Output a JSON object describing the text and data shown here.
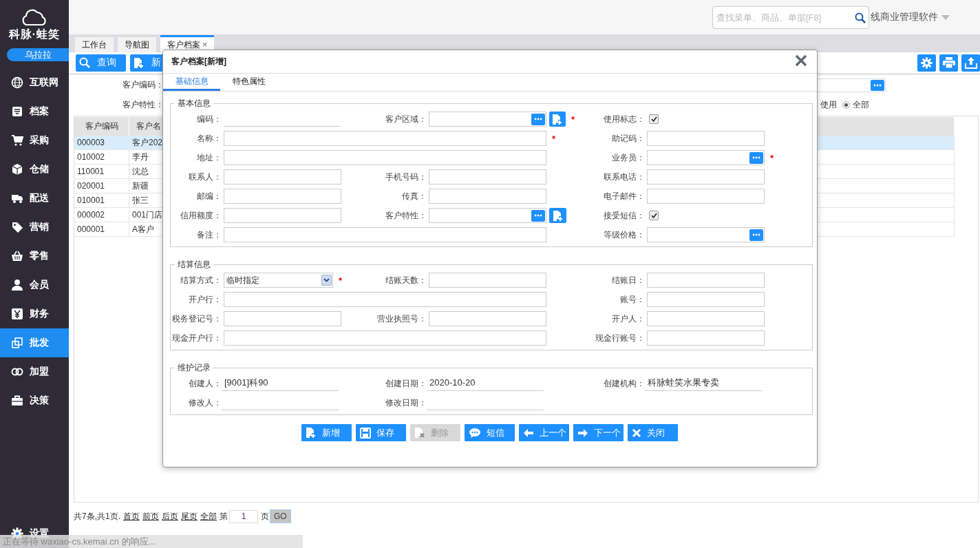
{
  "sidebar": {
    "logo": "科脉·蛙笑",
    "user": "乌拉拉",
    "items": [
      {
        "label": "互联网",
        "selected": false
      },
      {
        "label": "档案",
        "selected": false
      },
      {
        "label": "采购",
        "selected": false
      },
      {
        "label": "仓储",
        "selected": false
      },
      {
        "label": "配送",
        "selected": false
      },
      {
        "label": "营销",
        "selected": false
      },
      {
        "label": "零售",
        "selected": false
      },
      {
        "label": "会员",
        "selected": false
      },
      {
        "label": "财务",
        "selected": false
      },
      {
        "label": "批发",
        "selected": true
      },
      {
        "label": "加盟",
        "selected": false
      },
      {
        "label": "决策",
        "selected": false
      }
    ],
    "settings": "设置"
  },
  "topbar": {
    "search_placeholder": "查找菜单、商品、单据[F8]",
    "product": "线商业管理软件"
  },
  "tabs": [
    {
      "label": "工作台",
      "selected": false
    },
    {
      "label": "导航图",
      "selected": false
    },
    {
      "label": "客户档案",
      "selected": true,
      "close": "×"
    }
  ],
  "toolbar": {
    "buttons": [
      {
        "kind": "search",
        "label": "查询"
      },
      {
        "kind": "add",
        "label": "新"
      }
    ]
  },
  "filters": {
    "fields": [
      {
        "label": "客户编码："
      },
      {
        "label": "客户特性："
      }
    ],
    "partial_label": "使用",
    "radios": [
      {
        "label": "全部",
        "selected": true
      }
    ]
  },
  "table": {
    "columns": [
      "客户编码",
      "客户名"
    ],
    "rows": [
      {
        "cells": [
          "000003",
          "客户202"
        ],
        "selected": true
      },
      {
        "cells": [
          "010002",
          "李丹"
        ],
        "selected": false
      },
      {
        "cells": [
          "110001",
          "沈总"
        ],
        "selected": false
      },
      {
        "cells": [
          "020001",
          "新疆"
        ],
        "selected": false
      },
      {
        "cells": [
          "010001",
          "张三"
        ],
        "selected": false
      },
      {
        "cells": [
          "000002",
          "001门店"
        ],
        "selected": false
      },
      {
        "cells": [
          "000001",
          "A客户"
        ],
        "selected": false
      }
    ]
  },
  "pager": {
    "summary": "共7条,共1页.",
    "links": [
      "首页",
      "前页",
      "后页",
      "尾页",
      "全部"
    ],
    "page_prefix": "第",
    "page": "1",
    "page_suffix": "页",
    "go": "GO"
  },
  "status_bar": "正在等待 waxiao-cs.kemai.cn 的响应...",
  "dialog": {
    "title": "客户档案[新增]",
    "tabs": [
      {
        "label": "基础信息",
        "selected": true
      },
      {
        "label": "特色属性",
        "selected": false
      }
    ],
    "sections": [
      {
        "title": "基本信息",
        "rows": [
          {
            "fields": [
              {
                "label": "编码：",
                "kind": "underline"
              },
              {
                "label": "客户区域：",
                "kind": "lookup",
                "add": true,
                "required_mark": "*"
              },
              {
                "label": "使用标志：",
                "kind": "checkbox",
                "checked": true
              }
            ]
          },
          {
            "fields": [
              {
                "label": "名称：",
                "kind": "text",
                "wide": true,
                "required_mark": "*"
              },
              {
                "label": "助记码：",
                "kind": "text"
              }
            ]
          },
          {
            "fields": [
              {
                "label": "地址：",
                "kind": "text",
                "wide": true
              },
              {
                "label": "业务员：",
                "kind": "lookup",
                "required_mark": "*"
              }
            ]
          },
          {
            "fields": [
              {
                "label": "联系人：",
                "kind": "text"
              },
              {
                "label": "手机号码：",
                "kind": "text"
              },
              {
                "label": "联系电话：",
                "kind": "text"
              }
            ]
          },
          {
            "fields": [
              {
                "label": "邮编：",
                "kind": "text"
              },
              {
                "label": "传真：",
                "kind": "text"
              },
              {
                "label": "电子邮件：",
                "kind": "text"
              }
            ]
          },
          {
            "fields": [
              {
                "label": "信用额度：",
                "kind": "text"
              },
              {
                "label": "客户特性：",
                "kind": "lookup",
                "add": true
              },
              {
                "label": "接受短信：",
                "kind": "checkbox",
                "checked": true
              }
            ]
          },
          {
            "fields": [
              {
                "label": "备注：",
                "kind": "text",
                "wide": true
              },
              {
                "label": "等级价格：",
                "kind": "lookup"
              }
            ]
          }
        ]
      },
      {
        "title": "结算信息",
        "rows": [
          {
            "fields": [
              {
                "label": "结算方式：",
                "kind": "select",
                "value": "临时指定",
                "required_mark": "*"
              },
              {
                "label": "结账天数：",
                "kind": "text"
              },
              {
                "label": "结账日：",
                "kind": "text"
              }
            ]
          },
          {
            "fields": [
              {
                "label": "开户行：",
                "kind": "text",
                "wide": true
              },
              {
                "label": "账号：",
                "kind": "text"
              }
            ]
          },
          {
            "fields": [
              {
                "label": "税务登记号：",
                "kind": "text"
              },
              {
                "label": "营业执照号：",
                "kind": "text"
              },
              {
                "label": "开户人：",
                "kind": "text"
              }
            ]
          },
          {
            "fields": [
              {
                "label": "现金开户行：",
                "kind": "text",
                "wide": true
              },
              {
                "label": "现金行账号：",
                "kind": "text"
              }
            ]
          }
        ]
      },
      {
        "title": "维护记录",
        "rows": [
          {
            "fields": [
              {
                "label": "创建人：",
                "kind": "display",
                "value": "[9001]科90"
              },
              {
                "label": "创建日期：",
                "kind": "display",
                "value": "2020-10-20"
              },
              {
                "label": "创建机构：",
                "kind": "display",
                "value": "科脉蛙笑水果专卖"
              }
            ]
          },
          {
            "fields": [
              {
                "label": "修改人：",
                "kind": "display"
              },
              {
                "label": "修改日期：",
                "kind": "display"
              }
            ]
          }
        ]
      }
    ],
    "buttons": [
      {
        "kind": "add",
        "label": "新增",
        "disabled": false
      },
      {
        "kind": "save",
        "label": "保存",
        "disabled": false
      },
      {
        "kind": "delete",
        "label": "删除",
        "disabled": true
      },
      {
        "kind": "message",
        "label": "短信",
        "disabled": false
      },
      {
        "kind": "prev",
        "label": "上一个",
        "disabled": false
      },
      {
        "kind": "next",
        "label": "下一个",
        "disabled": false
      },
      {
        "kind": "close",
        "label": "关闭",
        "disabled": false
      }
    ]
  }
}
